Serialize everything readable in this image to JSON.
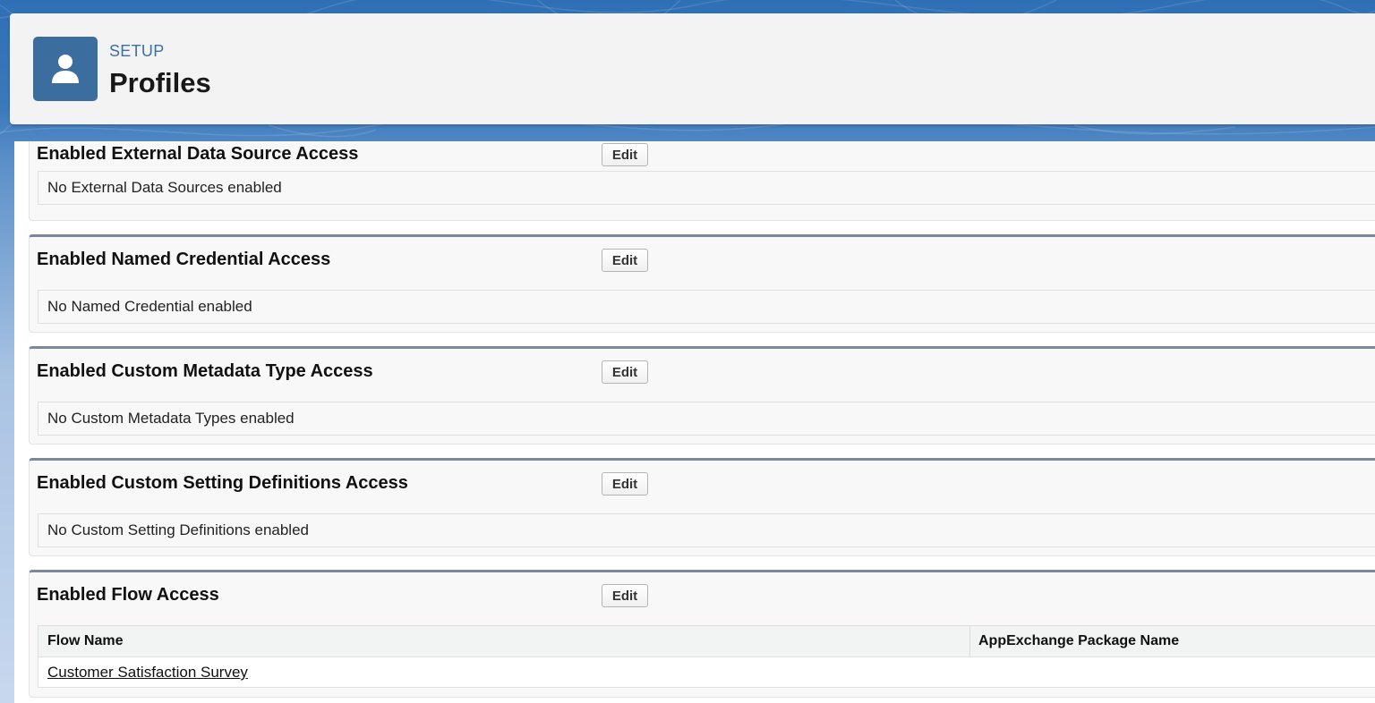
{
  "header": {
    "icon": "user-icon",
    "eyebrow": "SETUP",
    "title": "Profiles"
  },
  "sections": [
    {
      "title": "Enabled External Data Source Access",
      "edit_label": "Edit",
      "empty_text": "No External Data Sources enabled"
    },
    {
      "title": "Enabled Named Credential Access",
      "edit_label": "Edit",
      "empty_text": "No Named Credential enabled"
    },
    {
      "title": "Enabled Custom Metadata Type Access",
      "edit_label": "Edit",
      "empty_text": "No Custom Metadata Types enabled"
    },
    {
      "title": "Enabled Custom Setting Definitions Access",
      "edit_label": "Edit",
      "empty_text": "No Custom Setting Definitions enabled"
    },
    {
      "title": "Enabled Flow Access",
      "edit_label": "Edit",
      "columns": [
        "Flow Name",
        "AppExchange Package Name"
      ],
      "rows": [
        {
          "flow_name": "Customer Satisfaction Survey",
          "package_name": ""
        }
      ]
    }
  ],
  "colors": {
    "header_icon_bg": "#3b6e9e",
    "eyebrow": "#3d6fa8",
    "section_border_top": "#7d8799"
  }
}
